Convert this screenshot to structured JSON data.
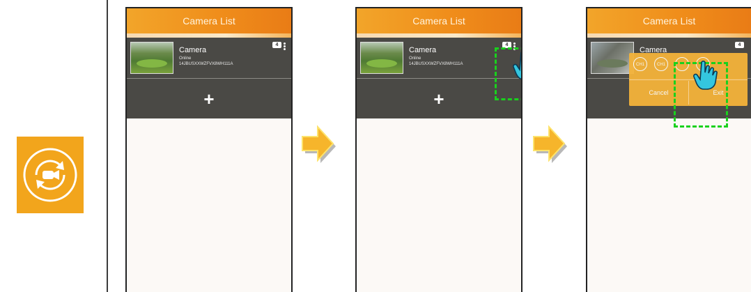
{
  "app": {
    "header_title": "Camera List",
    "add_label": "+"
  },
  "camera": {
    "name": "Camera",
    "status": "Online",
    "uid": "14JBUSXXWZFVX8WH111A",
    "channel_count": "4"
  },
  "popup": {
    "channels": [
      "CH1",
      "CH1",
      "",
      ""
    ],
    "cancel_label": "Cancel",
    "ok_label": "Exit"
  },
  "colors": {
    "accent": "#f2a51c",
    "header_gradient_start": "#f2a52a",
    "list_background": "#4a4945",
    "selection": "#19d11d",
    "pointer": "#34c6df"
  },
  "icons": {
    "left": "camera-switch-icon",
    "step_arrow": "arrow-right-icon",
    "pointer": "hand-pointer-icon"
  }
}
